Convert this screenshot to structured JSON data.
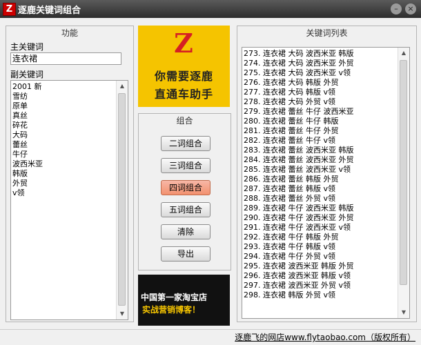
{
  "window": {
    "title": "逐鹿关键词组合",
    "app_icon_glyph": "Z",
    "minimize_glyph": "–",
    "close_glyph": "×"
  },
  "left_panel": {
    "title": "功能",
    "main_keyword_label": "主关键词",
    "main_keyword_value": "连衣裙",
    "sub_keywords_label": "副关键词",
    "sub_keywords": [
      "2001 新",
      "雪纺",
      "原单",
      "真丝",
      "碎花",
      "大码",
      "蕾丝",
      "牛仔",
      "波西米亚",
      "韩版",
      "外贸",
      "v领"
    ]
  },
  "logo": {
    "letter": "Z",
    "line1": "你需要逐鹿",
    "line2": "直通车助手"
  },
  "combine_panel": {
    "title": "组合",
    "buttons": [
      {
        "label": "二词组合",
        "active": false
      },
      {
        "label": "三词组合",
        "active": false
      },
      {
        "label": "四词组合",
        "active": true
      },
      {
        "label": "五词组合",
        "active": false
      },
      {
        "label": "清除",
        "active": false
      },
      {
        "label": "导出",
        "active": false
      }
    ]
  },
  "ad": {
    "line1": "中国第一家淘宝店",
    "line2": "实战营销博客！"
  },
  "right_panel": {
    "title": "关键词列表",
    "items": [
      "273. 连衣裙 大码 波西米亚 韩版",
      "274. 连衣裙 大码 波西米亚 外贸",
      "275. 连衣裙 大码 波西米亚 v领",
      "276. 连衣裙 大码 韩版 外贸",
      "277. 连衣裙 大码 韩版 v领",
      "278. 连衣裙 大码 外贸 v领",
      "279. 连衣裙 蕾丝 牛仔 波西米亚",
      "280. 连衣裙 蕾丝 牛仔 韩版",
      "281. 连衣裙 蕾丝 牛仔 外贸",
      "282. 连衣裙 蕾丝 牛仔 v领",
      "283. 连衣裙 蕾丝 波西米亚 韩版",
      "284. 连衣裙 蕾丝 波西米亚 外贸",
      "285. 连衣裙 蕾丝 波西米亚 v领",
      "286. 连衣裙 蕾丝 韩版 外贸",
      "287. 连衣裙 蕾丝 韩版 v领",
      "288. 连衣裙 蕾丝 外贸 v领",
      "289. 连衣裙 牛仔 波西米亚 韩版",
      "290. 连衣裙 牛仔 波西米亚 外贸",
      "291. 连衣裙 牛仔 波西米亚 v领",
      "292. 连衣裙 牛仔 韩版 外贸",
      "293. 连衣裙 牛仔 韩版 v领",
      "294. 连衣裙 牛仔 外贸 v领",
      "295. 连衣裙 波西米亚 韩版 外贸",
      "296. 连衣裙 波西米亚 韩版 v领",
      "297. 连衣裙 波西米亚 外贸 v领",
      "298. 连衣裙 韩版 外贸 v领"
    ]
  },
  "status_bar": {
    "text": "逐鹿飞的网店www.flytaobao.com（版权所有）"
  }
}
